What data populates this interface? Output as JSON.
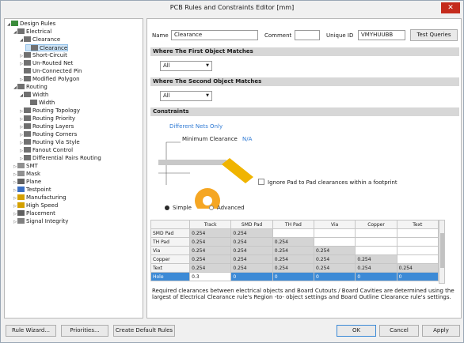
{
  "window": {
    "title": "PCB Rules and Constraints Editor [mm]",
    "close": "✕"
  },
  "tree": [
    {
      "label": "Design Rules",
      "depth": 0,
      "arrow": "◢",
      "icon": "folder",
      "color": "#3b8c3b"
    },
    {
      "label": "Electrical",
      "depth": 1,
      "arrow": "◢",
      "icon": "rule"
    },
    {
      "label": "Clearance",
      "depth": 2,
      "arrow": "◢",
      "icon": "rule"
    },
    {
      "label": "Clearance",
      "depth": 3,
      "arrow": "",
      "icon": "rule",
      "selected": true
    },
    {
      "label": "Short-Circuit",
      "depth": 2,
      "arrow": "▷",
      "icon": "rule"
    },
    {
      "label": "Un-Routed Net",
      "depth": 2,
      "arrow": "▷",
      "icon": "rule"
    },
    {
      "label": "Un-Connected Pin",
      "depth": 2,
      "arrow": "",
      "icon": "rule"
    },
    {
      "label": "Modified Polygon",
      "depth": 2,
      "arrow": "▷",
      "icon": "rule"
    },
    {
      "label": "Routing",
      "depth": 1,
      "arrow": "◢",
      "icon": "route"
    },
    {
      "label": "Width",
      "depth": 2,
      "arrow": "◢",
      "icon": "route"
    },
    {
      "label": "Width",
      "depth": 3,
      "arrow": "",
      "icon": "route"
    },
    {
      "label": "Routing Topology",
      "depth": 2,
      "arrow": "▷",
      "icon": "route"
    },
    {
      "label": "Routing Priority",
      "depth": 2,
      "arrow": "▷",
      "icon": "route"
    },
    {
      "label": "Routing Layers",
      "depth": 2,
      "arrow": "▷",
      "icon": "route"
    },
    {
      "label": "Routing Corners",
      "depth": 2,
      "arrow": "▷",
      "icon": "route"
    },
    {
      "label": "Routing Via Style",
      "depth": 2,
      "arrow": "▷",
      "icon": "route"
    },
    {
      "label": "Fanout Control",
      "depth": 2,
      "arrow": "▷",
      "icon": "route"
    },
    {
      "label": "Differential Pairs Routing",
      "depth": 2,
      "arrow": "▷",
      "icon": "route"
    },
    {
      "label": "SMT",
      "depth": 1,
      "arrow": "▷",
      "icon": "smt"
    },
    {
      "label": "Mask",
      "depth": 1,
      "arrow": "▷",
      "icon": "mask"
    },
    {
      "label": "Plane",
      "depth": 1,
      "arrow": "▷",
      "icon": "plane"
    },
    {
      "label": "Testpoint",
      "depth": 1,
      "arrow": "▷",
      "icon": "testpoint"
    },
    {
      "label": "Manufacturing",
      "depth": 1,
      "arrow": "▷",
      "icon": "manufacturing"
    },
    {
      "label": "High Speed",
      "depth": 1,
      "arrow": "▷",
      "icon": "highspeed"
    },
    {
      "label": "Placement",
      "depth": 1,
      "arrow": "▷",
      "icon": "placement"
    },
    {
      "label": "Signal Integrity",
      "depth": 1,
      "arrow": "▷",
      "icon": "signal"
    }
  ],
  "rule": {
    "name_label": "Name",
    "name_value": "Clearance",
    "comment_label": "Comment",
    "comment_value": "",
    "uid_label": "Unique ID",
    "uid_value": "VMYHUUBB",
    "test_queries": "Test Queries"
  },
  "first_match": {
    "title": "Where The First Object Matches",
    "value": "All"
  },
  "second_match": {
    "title": "Where The Second Object Matches",
    "value": "All"
  },
  "constraints": {
    "title": "Constraints",
    "net_scope": "Different Nets Only",
    "min_clearance_label": "Minimum Clearance",
    "min_clearance_value": "N/A",
    "ignore_pad": "Ignore Pad to Pad clearances within a footprint",
    "simple": "Simple",
    "advanced": "Advanced",
    "columns": [
      "",
      "Track",
      "SMD Pad",
      "TH Pad",
      "Via",
      "Copper",
      "Text"
    ],
    "rows": [
      {
        "name": "SMD Pad",
        "cells": [
          "0.254",
          "0.254",
          "",
          "",
          "",
          ""
        ]
      },
      {
        "name": "TH Pad",
        "cells": [
          "0.254",
          "0.254",
          "0.254",
          "",
          "",
          ""
        ]
      },
      {
        "name": "Via",
        "cells": [
          "0.254",
          "0.254",
          "0.254",
          "0.254",
          "",
          ""
        ]
      },
      {
        "name": "Copper",
        "cells": [
          "0.254",
          "0.254",
          "0.254",
          "0.254",
          "0.254",
          ""
        ]
      },
      {
        "name": "Text",
        "cells": [
          "0.254",
          "0.254",
          "0.254",
          "0.254",
          "0.254",
          "0.254"
        ]
      },
      {
        "name": "Hole",
        "cells": [
          "0.3",
          "0",
          "0",
          "0",
          "0",
          "0"
        ]
      }
    ],
    "note": "Required clearances between electrical objects and Board Cutouts / Board Cavities are determined using the largest of Electrical Clearance rule's Region -to- object settings and Board Outline Clearance rule's settings."
  },
  "buttons": {
    "rule_wizard": "Rule Wizard...",
    "priorities": "Priorities...",
    "create_default": "Create Default Rules",
    "ok": "OK",
    "cancel": "Cancel",
    "apply": "Apply"
  },
  "colors": {
    "accent": "#3c8ad6",
    "pad": "#f5a623",
    "track": "#c8a000"
  }
}
